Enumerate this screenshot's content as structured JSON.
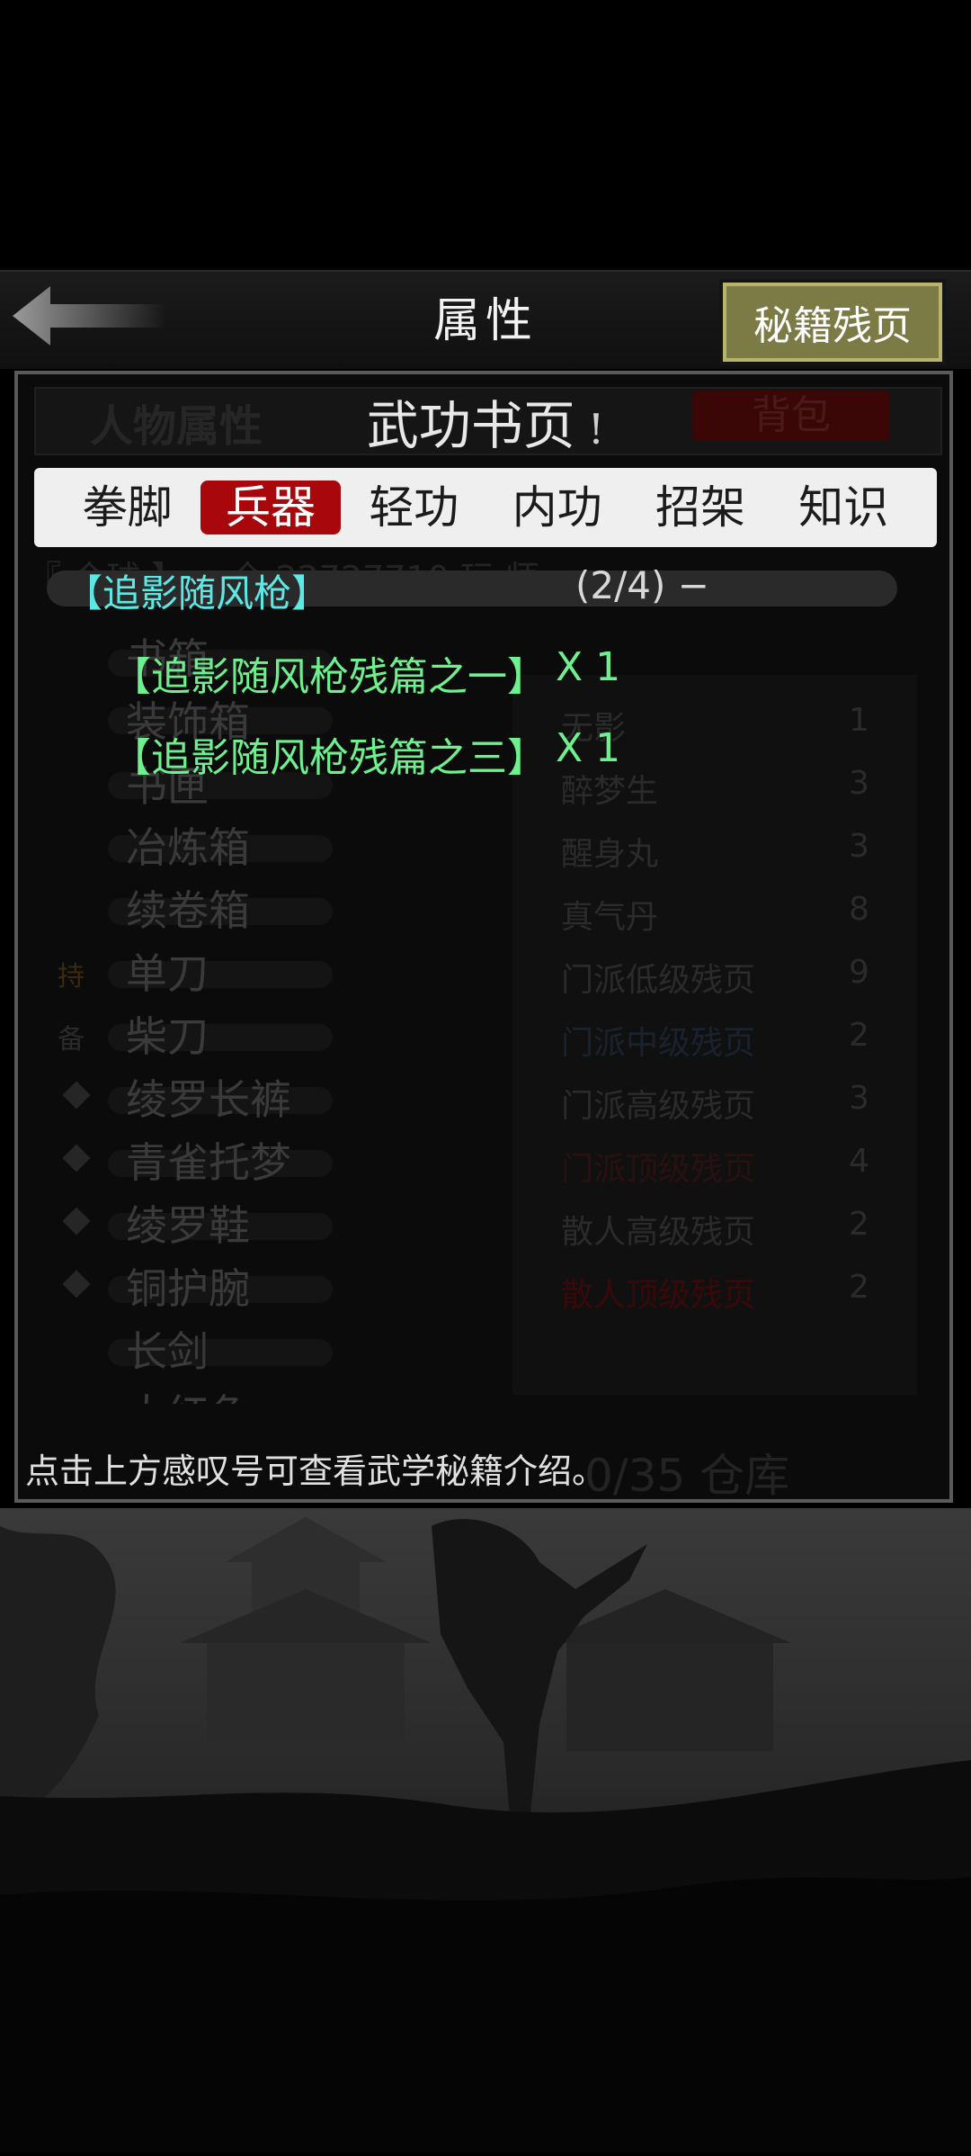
{
  "header": {
    "title": "属性",
    "right_button": "秘籍残页"
  },
  "background": {
    "tab_left": "人物属性",
    "tab_right": "背包",
    "scroll_text": "『 今球 】一 全 22727710 玩 师",
    "left_items": [
      "书箱",
      "装饰箱",
      "书匣",
      "冶炼箱",
      "续卷箱",
      "单刀",
      "柴刀",
      "绫罗长裤",
      "青雀托梦",
      "绫罗鞋",
      "铜护腕",
      "长剑",
      "大红色"
    ],
    "tags": [
      "持",
      "备"
    ],
    "right_items": [
      {
        "name": "无影",
        "count": "1"
      },
      {
        "name": "醉梦生",
        "count": "3"
      },
      {
        "name": "醒身丸",
        "count": "3"
      },
      {
        "name": "真气丹",
        "count": "8"
      },
      {
        "name": "门派低级残页",
        "count": "9"
      },
      {
        "name": "门派中级残页",
        "count": "2"
      },
      {
        "name": "门派高级残页",
        "count": "3"
      },
      {
        "name": "门派顶级残页",
        "count": "4"
      },
      {
        "name": "散人高级残页",
        "count": "2"
      },
      {
        "name": "散人顶级残页",
        "count": "2"
      }
    ],
    "footer": "0/35 仓库"
  },
  "popup": {
    "title": "武功书页",
    "info_mark": "!",
    "tabs": [
      {
        "label": "拳脚",
        "active": false
      },
      {
        "label": "兵器",
        "active": true
      },
      {
        "label": "轻功",
        "active": false
      },
      {
        "label": "内功",
        "active": false
      },
      {
        "label": "招架",
        "active": false
      },
      {
        "label": "知识",
        "active": false
      }
    ],
    "group": {
      "name": "【追影随风枪】",
      "count": "(2/4) −"
    },
    "pages": [
      {
        "name": "【追影随风枪残篇之一】",
        "qty": "X 1"
      },
      {
        "name": "【追影随风枪残篇之三】",
        "qty": "X 1"
      }
    ],
    "hint": "点击上方感叹号可查看武学秘籍介绍。"
  },
  "colors": {
    "accent_red": "#a8070b",
    "cyan_text": "#5de8e3",
    "green_text": "#6df08d",
    "button_olive": "#7d7b45"
  }
}
